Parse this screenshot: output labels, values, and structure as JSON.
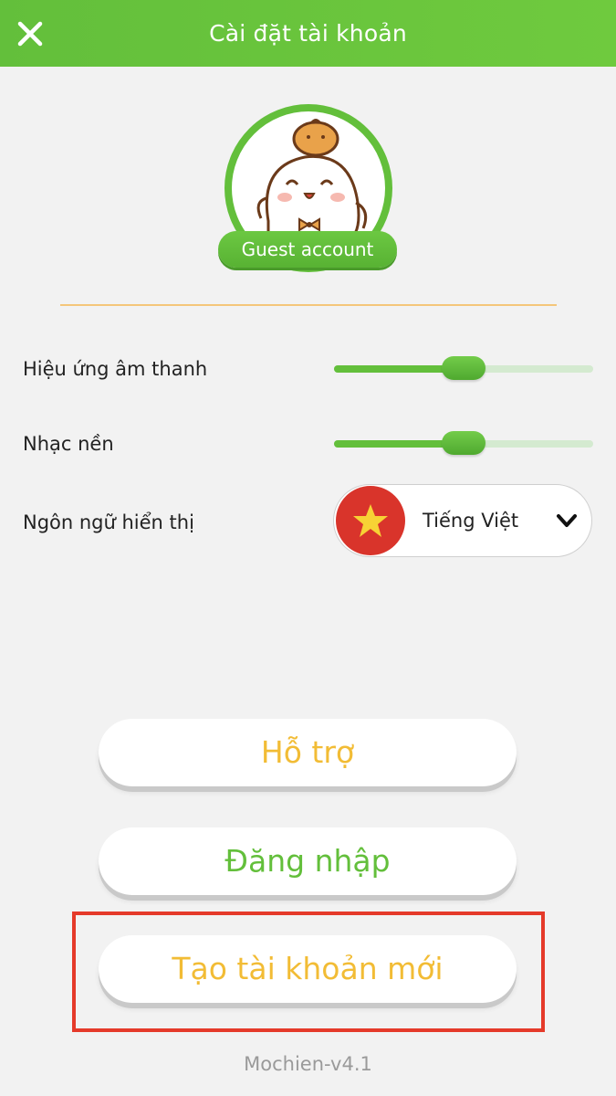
{
  "header": {
    "title": "Cài đặt tài khoản",
    "close_icon": "close-icon"
  },
  "profile": {
    "avatar_icon": "mascot-avatar-icon",
    "badge_label": "Guest account"
  },
  "settings": {
    "sound_effects": {
      "label": "Hiệu ứng âm thanh",
      "value_fraction": 0.45
    },
    "background_music": {
      "label": "Nhạc nền",
      "value_fraction": 0.45
    },
    "language": {
      "label": "Ngôn ngữ hiển thị",
      "value": "Tiếng Việt",
      "flag_icon": "vietnam-flag-icon"
    }
  },
  "buttons": {
    "support": {
      "label": "Hỗ trợ",
      "color": "#f2bc35"
    },
    "login": {
      "label": "Đăng nhập",
      "color": "#63bf3b"
    },
    "create_account": {
      "label": "Tạo tài khoản mới",
      "color": "#f2bc35"
    }
  },
  "footer": {
    "version": "Mochien-v4.1"
  },
  "colors": {
    "primary_green": "#63bf3b",
    "accent_orange": "#f2bc35",
    "highlight_red": "#e53a2a"
  }
}
